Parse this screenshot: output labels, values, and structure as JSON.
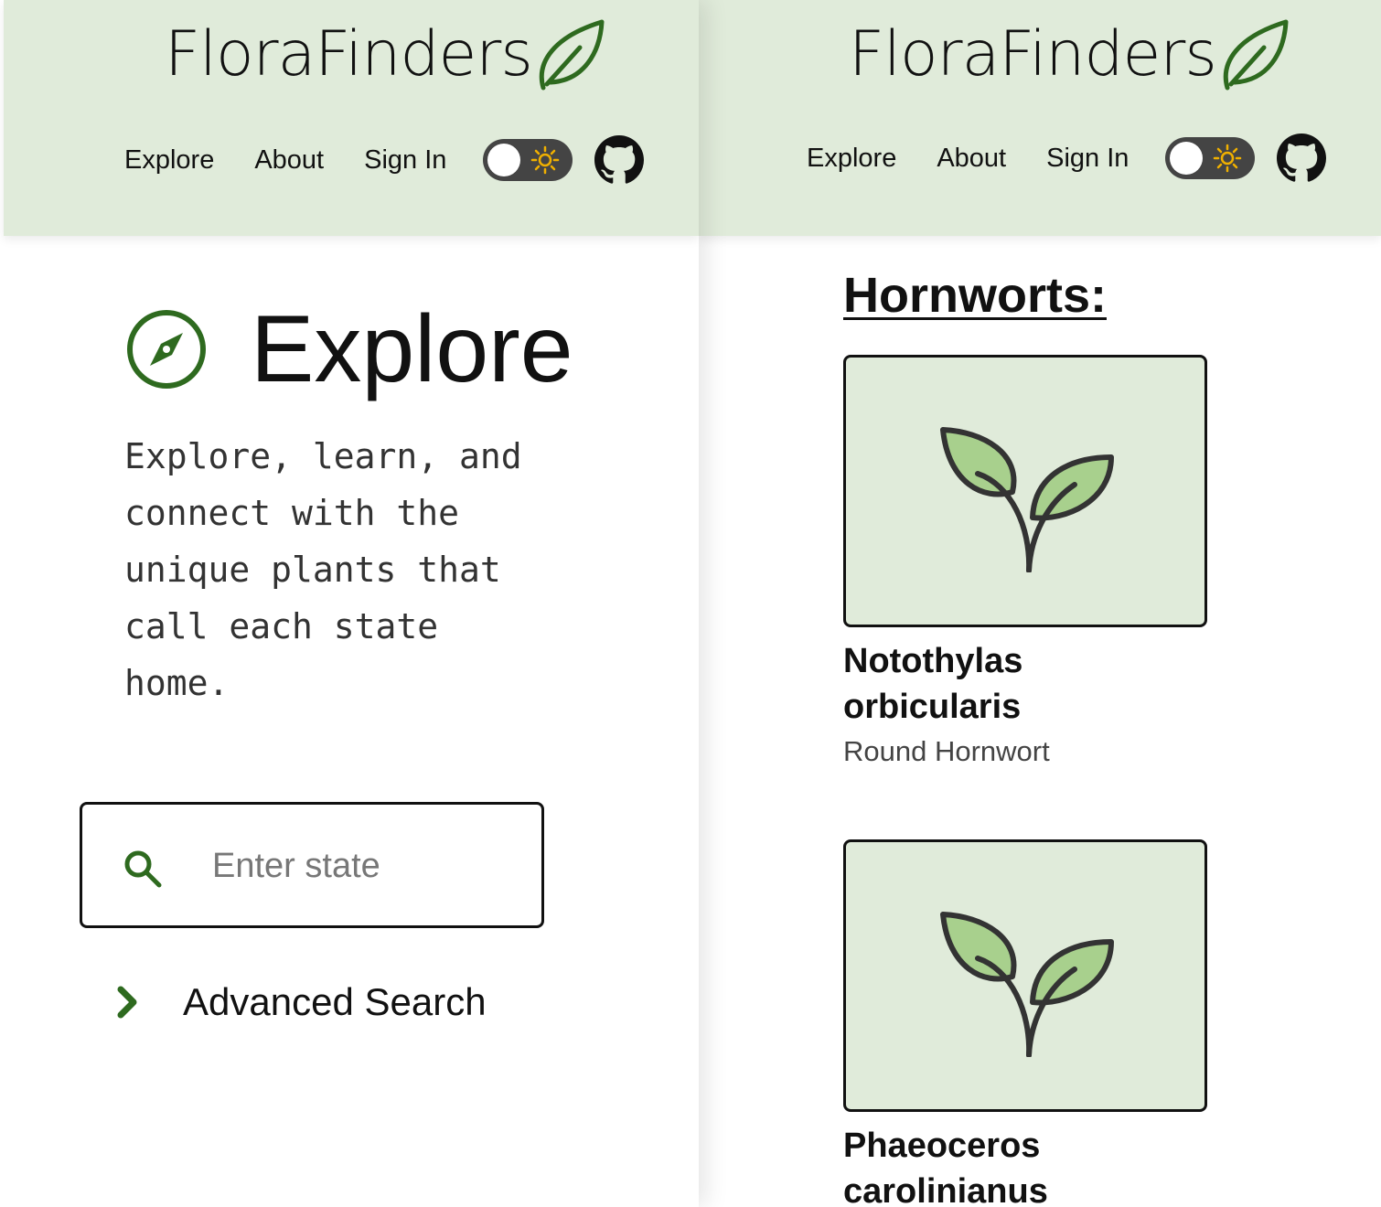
{
  "brand": {
    "name": "FloraFinders"
  },
  "nav": {
    "explore": "Explore",
    "about": "About",
    "sign_in": "Sign In"
  },
  "explore_page": {
    "title": "Explore",
    "intro": "Explore, learn, and connect with the unique plants that call each state home.",
    "search_placeholder": "Enter state",
    "advanced_search": "Advanced Search"
  },
  "results": {
    "section_title": "Hornworts:",
    "cards": [
      {
        "scientific_name": "Notothylas orbicularis",
        "common_name": "Round Hornwort"
      },
      {
        "scientific_name": "Phaeoceros carolinianus",
        "common_name": ""
      }
    ]
  },
  "colors": {
    "header_bg": "#e0ebda",
    "accent_green": "#2e6a1f",
    "leaf_fill": "#a8d08d",
    "toggle_bg": "#444444",
    "sun": "#f0b000"
  },
  "icons": {
    "brand": "leaf-icon",
    "theme": "sun-icon",
    "github": "github-icon",
    "explore": "compass-icon",
    "search": "search-icon",
    "advanced": "chevron-right-icon",
    "card": "sprout-icon"
  }
}
